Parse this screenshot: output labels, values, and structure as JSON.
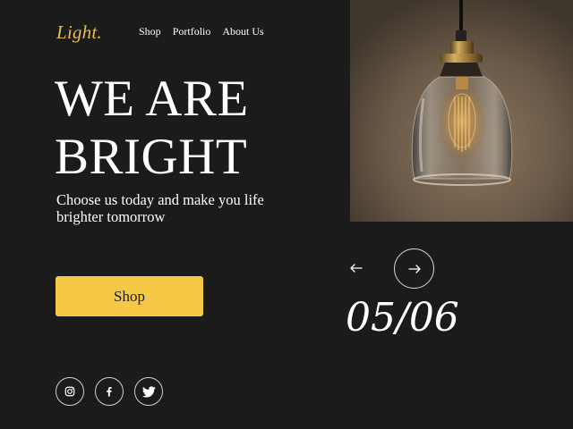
{
  "brand": {
    "logo": "Light.",
    "accent_color": "#e5bf45"
  },
  "nav": {
    "items": [
      {
        "label": "Shop"
      },
      {
        "label": "Portfolio"
      },
      {
        "label": "About Us"
      }
    ]
  },
  "hero": {
    "headline_line1": "WE ARE",
    "headline_line2": "BRIGHT",
    "tagline": "Choose us today and make you life brighter tomorrow",
    "cta_label": "Shop",
    "cta_color": "#f5c945",
    "image": "pendant-lamp-edison-bulb-photo"
  },
  "slider": {
    "prev_icon": "arrow-left-icon",
    "next_icon": "arrow-right-icon",
    "counter": "05/06"
  },
  "socials": [
    {
      "icon": "instagram-icon"
    },
    {
      "icon": "facebook-icon"
    },
    {
      "icon": "twitter-icon"
    }
  ],
  "background_color": "#1b1b1b"
}
